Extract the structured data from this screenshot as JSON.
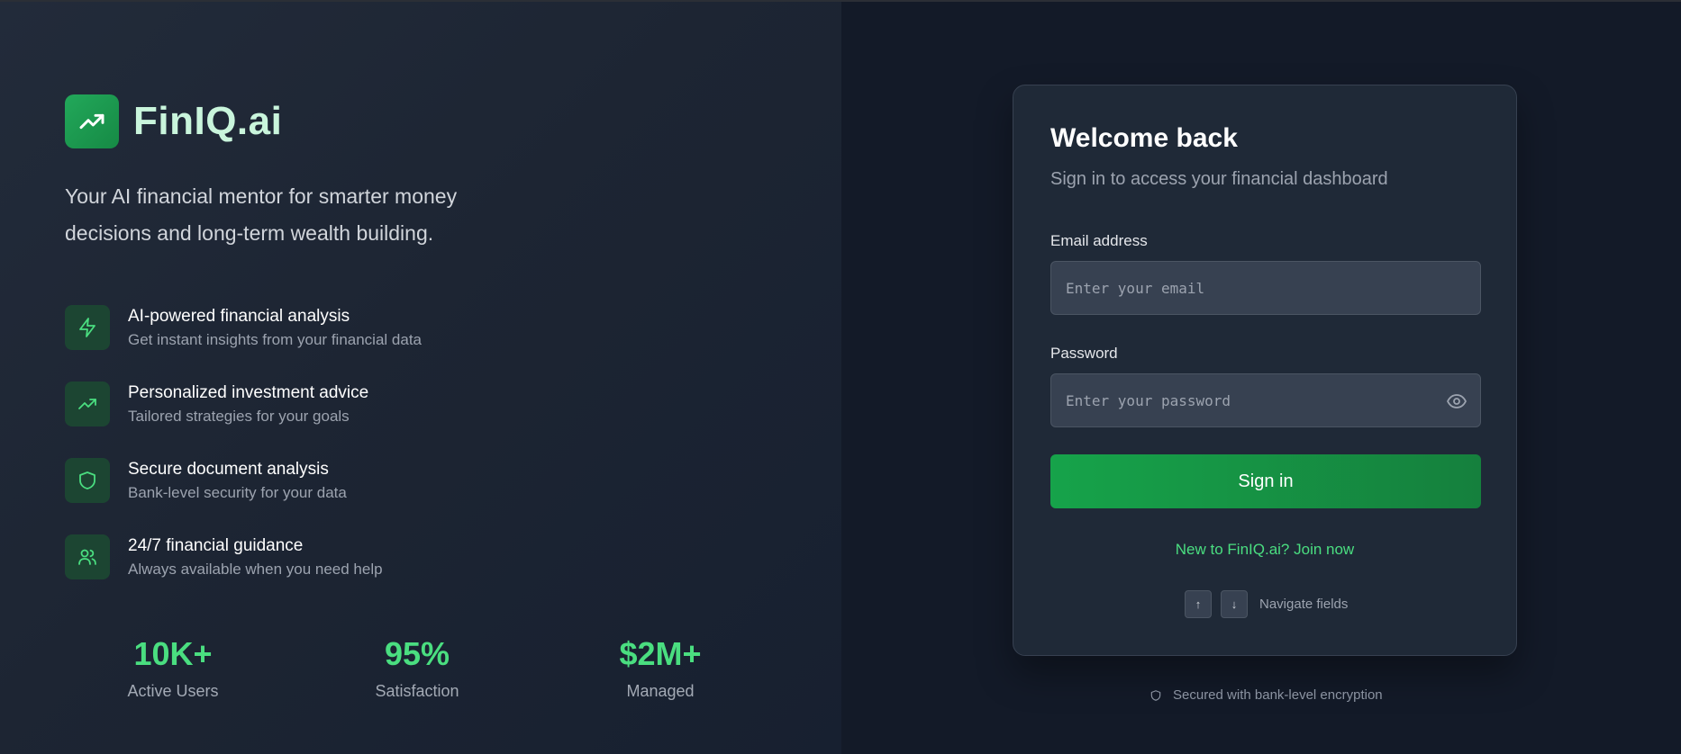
{
  "brand": {
    "name": "FinIQ.ai",
    "tagline": "Your AI financial mentor for smarter money decisions and long-term wealth building.",
    "logo_icon": "trending-up-icon",
    "accent_color": "#22a85a"
  },
  "features": [
    {
      "icon": "lightning-icon",
      "title": "AI-powered financial analysis",
      "desc": "Get instant insights from your financial data"
    },
    {
      "icon": "trending-up-icon",
      "title": "Personalized investment advice",
      "desc": "Tailored strategies for your goals"
    },
    {
      "icon": "shield-icon",
      "title": "Secure document analysis",
      "desc": "Bank-level security for your data"
    },
    {
      "icon": "users-icon",
      "title": "24/7 financial guidance",
      "desc": "Always available when you need help"
    }
  ],
  "stats": [
    {
      "value": "10K+",
      "label": "Active Users"
    },
    {
      "value": "95%",
      "label": "Satisfaction"
    },
    {
      "value": "$2M+",
      "label": "Managed"
    }
  ],
  "login": {
    "title": "Welcome back",
    "subtitle": "Sign in to access your financial dashboard",
    "email_label": "Email address",
    "email_placeholder": "Enter your email",
    "email_value": "",
    "password_label": "Password",
    "password_placeholder": "Enter your password",
    "password_value": "",
    "signin_label": "Sign in",
    "join_link": "New to FinIQ.ai? Join now",
    "nav_up_key": "↑",
    "nav_down_key": "↓",
    "nav_hint": "Navigate fields"
  },
  "footer": {
    "security_note": "Secured with bank-level encryption"
  },
  "colors": {
    "accent_green": "#4ade80",
    "button_green": "#16a34a",
    "card_bg": "#1f2937",
    "page_bg": "#111827"
  }
}
